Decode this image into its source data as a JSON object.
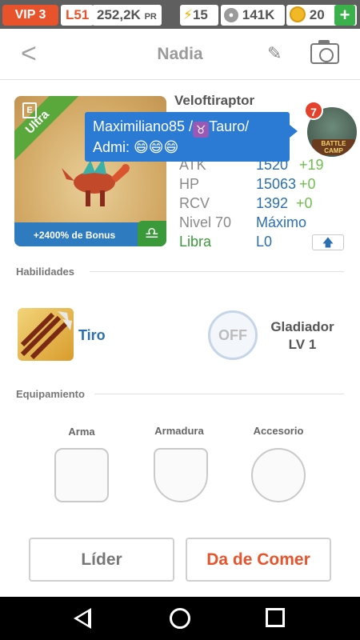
{
  "status": {
    "vip": "VIP 3",
    "level": "L51",
    "power_value": "252,2K",
    "power_unit": "PR",
    "energy": "15",
    "food": "141K",
    "coins": "20",
    "plus": "+"
  },
  "header": {
    "back": "<",
    "title": "Nadia"
  },
  "pet": {
    "rarity": "Ultra",
    "element": "E",
    "bonus": "+2400% de Bonus",
    "zodiac_symbol": "♎",
    "species": "Veloftiraptor",
    "stats": [
      {
        "label": "ATK",
        "value": "1520",
        "bonus": "+19"
      },
      {
        "label": "HP",
        "value": "15063",
        "bonus": "+0"
      },
      {
        "label": "RCV",
        "value": "1392",
        "bonus": "+0"
      },
      {
        "label": "Nivel 70",
        "value": "Máximo",
        "bonus": ""
      },
      {
        "label": "Libra",
        "value": "L0",
        "bonus": ""
      }
    ],
    "upgrade_arrow": "🡅"
  },
  "tooltip": {
    "line1_user": "Maximiliano85 /",
    "taurus_symbol": "♉",
    "line1_sign": "Tauro/",
    "line2": "Admi: 😄😄😄"
  },
  "avatar": {
    "badge": "7",
    "camp": "BATTLE CAMP"
  },
  "skills": {
    "section": "Habilidades",
    "skill_name": "Tiro",
    "off_label": "OFF",
    "passive_name": "Gladiador",
    "passive_level": "LV 1"
  },
  "equipment": {
    "section": "Equipamiento",
    "slots": [
      "Arma",
      "Armadura",
      "Accesorio"
    ]
  },
  "actions": {
    "leader": "Líder",
    "feed": "Da de Comer"
  },
  "colors": {
    "accent_orange": "#e8532b",
    "stat_blue": "#2a6fb0",
    "bonus_green": "#6fbf4e",
    "tooltip_blue": "#2b7ad4"
  }
}
